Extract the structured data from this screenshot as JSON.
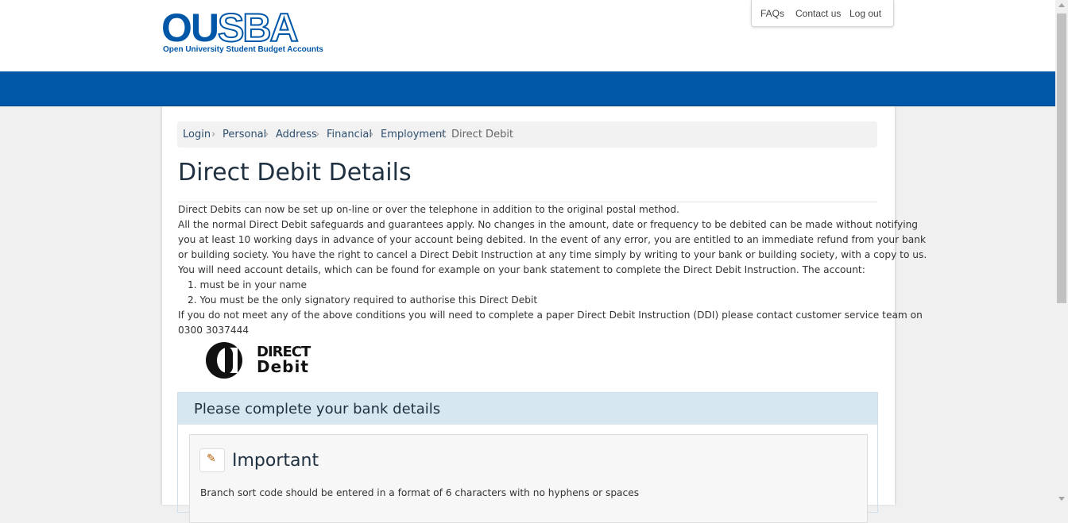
{
  "header": {
    "logo_ou": "OU",
    "logo_sba": "SBA",
    "logo_subtitle": "Open University Student Budget Accounts",
    "links": [
      "FAQs",
      "Contact us",
      "Log out"
    ]
  },
  "breadcrumb": [
    "Login",
    "Personal",
    "Address",
    "Financial",
    "Employment",
    "Direct Debit"
  ],
  "page": {
    "title": "Direct Debit Details",
    "intro_lines": [
      "Direct Debits can now be set up on-line or over the telephone in addition to the original postal method.",
      "All the normal Direct Debit safeguards and guarantees apply. No changes in the amount, date or frequency to be debited can be made without notifying",
      "you at least 10 working days in advance of your account being debited. In the event of any error, you are entitled to an immediate refund from your bank",
      "or building society. You have the right to cancel a Direct Debit Instruction at any time simply by writing to your bank or building society, with a copy to us.",
      "You will need account details, which can be found for example on your bank statement to complete the Direct Debit Instruction. The account:"
    ],
    "requirements": [
      "1. must be in your name",
      "2. You must be the only signatory required to authorise this Direct Debit"
    ],
    "closing_lines": [
      "If you do not meet any of the above conditions you will need to complete a paper Direct Debit Instruction (DDI) please contact customer service team on",
      "0300 3037444"
    ],
    "dd_logo_line1": "DIRECT",
    "dd_logo_line2": "Debit"
  },
  "bank_panel": {
    "title": "Please complete your bank details",
    "important_title": "Important",
    "important_icon": "pencil-icon",
    "important_text": "Branch sort code should be entered in a format of 6 characters with no hyphens or spaces"
  },
  "colors": {
    "brand_blue": "#0057a8",
    "panel_head": "#d6e7f0"
  }
}
